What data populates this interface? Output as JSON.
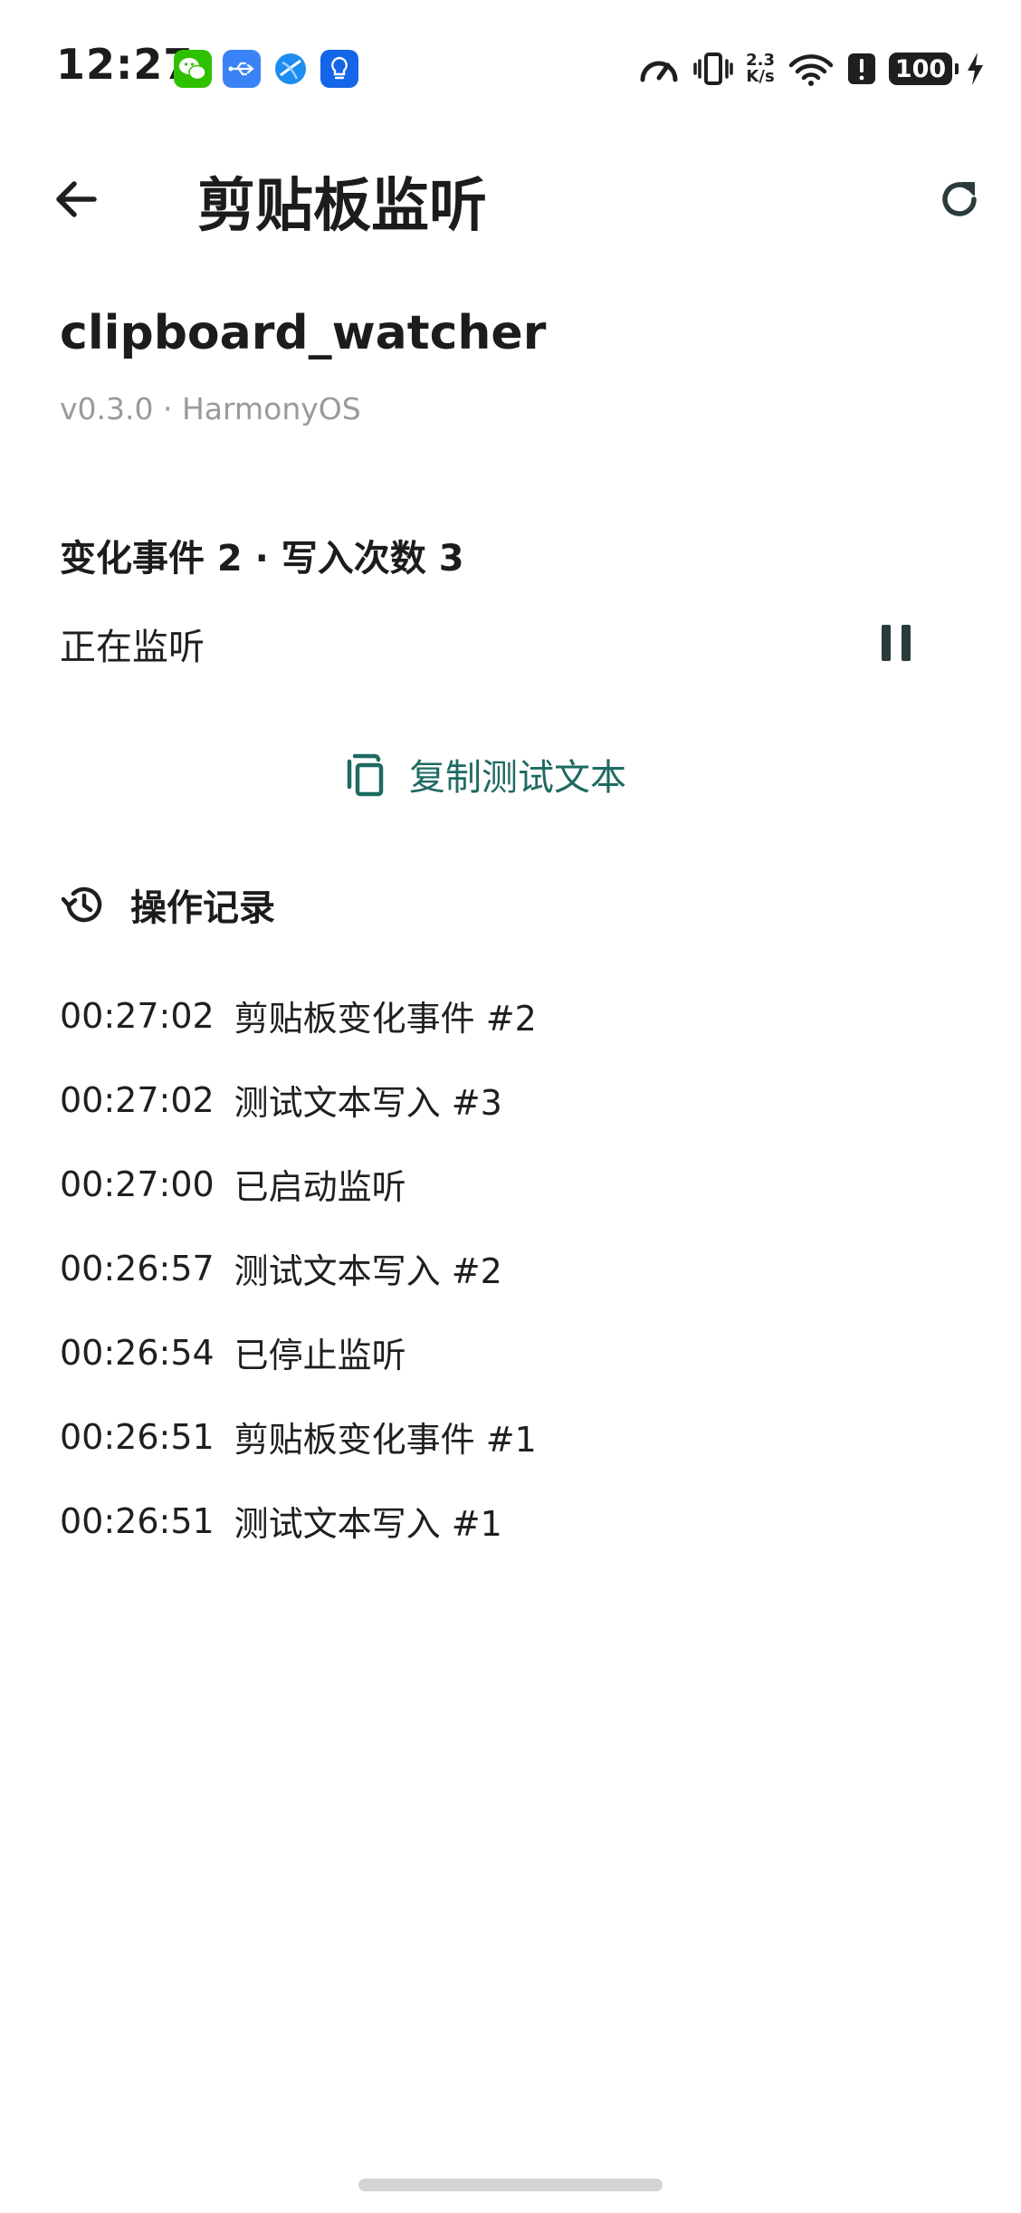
{
  "status_bar": {
    "time": "12:27",
    "app_icons": [
      {
        "name": "wechat-icon",
        "color": "#2dc100"
      },
      {
        "name": "usb-icon",
        "color": "#3b82f6"
      },
      {
        "name": "browser-icon",
        "color": "#1d8cf0"
      },
      {
        "name": "tips-bulb-icon",
        "color": "#1565e8"
      }
    ],
    "net_speed_value": "2.3",
    "net_speed_unit": "K/s",
    "battery": "100"
  },
  "app_bar": {
    "title": "剪贴板监听",
    "back_icon": "arrow-left-icon",
    "refresh_icon": "refresh-icon"
  },
  "package": {
    "name": "clipboard_watcher",
    "meta": "v0.3.0 · HarmonyOS"
  },
  "stats": {
    "summary": "变化事件 2 · 写入次数 3"
  },
  "listening": {
    "status": "正在监听",
    "toggle_icon": "pause-icon"
  },
  "actions": {
    "copy_label": "复制测试文本",
    "accent": "#1e6b62"
  },
  "history": {
    "title": "操作记录",
    "items": [
      {
        "time": "00:27:02",
        "text": "剪贴板变化事件 #2"
      },
      {
        "time": "00:27:02",
        "text": "测试文本写入 #3"
      },
      {
        "time": "00:27:00",
        "text": "已启动监听"
      },
      {
        "time": "00:26:57",
        "text": "测试文本写入 #2"
      },
      {
        "time": "00:26:54",
        "text": "已停止监听"
      },
      {
        "time": "00:26:51",
        "text": "剪贴板变化事件 #1"
      },
      {
        "time": "00:26:51",
        "text": "测试文本写入 #1"
      }
    ]
  }
}
